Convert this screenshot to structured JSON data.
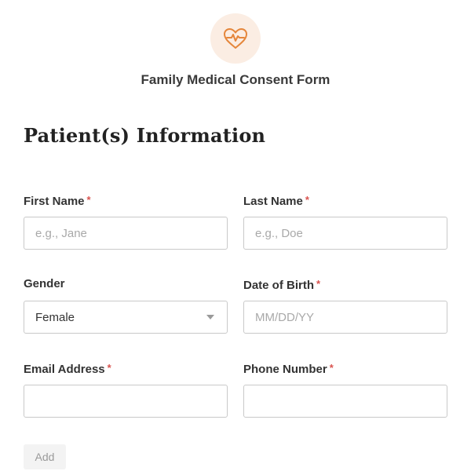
{
  "header": {
    "logo_icon": "heart-pulse-icon",
    "logo_color": "#e5863b",
    "logo_bg": "#fbede3",
    "title": "Family Medical Consent Form"
  },
  "section": {
    "heading": "Patient(s) Information"
  },
  "fields": {
    "first_name": {
      "label": "First Name",
      "required_mark": "*",
      "placeholder": "e.g., Jane",
      "value": ""
    },
    "last_name": {
      "label": "Last Name",
      "required_mark": "*",
      "placeholder": "e.g., Doe",
      "value": ""
    },
    "gender": {
      "label": "Gender",
      "selected": "Female"
    },
    "dob": {
      "label": "Date of Birth",
      "required_mark": "*",
      "placeholder": "MM/DD/YY",
      "value": ""
    },
    "email": {
      "label": "Email Address",
      "required_mark": "*",
      "placeholder": "",
      "value": ""
    },
    "phone": {
      "label": "Phone Number",
      "required_mark": "*",
      "placeholder": "",
      "value": ""
    }
  },
  "actions": {
    "add_label": "Add"
  },
  "colors": {
    "required": "#d9534f",
    "input_border": "#c9c9c9"
  }
}
